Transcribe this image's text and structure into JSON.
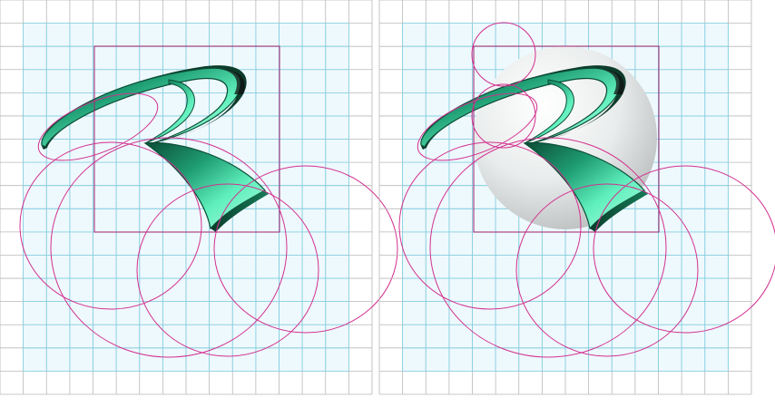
{
  "figure": {
    "panels": [
      {
        "id": "construction-grid",
        "shows_sphere": false
      },
      {
        "id": "construction-grid-with-sphere",
        "shows_sphere": true
      }
    ],
    "grid": {
      "columns": 16,
      "rows": 17,
      "line_color": "#b8b8b8",
      "inner_line_color": "#7fd3e8",
      "inner_fill": "#eef9fd"
    },
    "guides": {
      "circle_color": "#d2308f",
      "square_color": "#a0206f"
    },
    "logo": {
      "symbol": "ribbon-R",
      "gradient": [
        "#0b4d36",
        "#1f9d73",
        "#5ff0bd",
        "#b6fae0"
      ]
    },
    "sphere": {
      "gradient": [
        "#ffffff",
        "#e9ecec",
        "#b9bcbc"
      ]
    }
  }
}
